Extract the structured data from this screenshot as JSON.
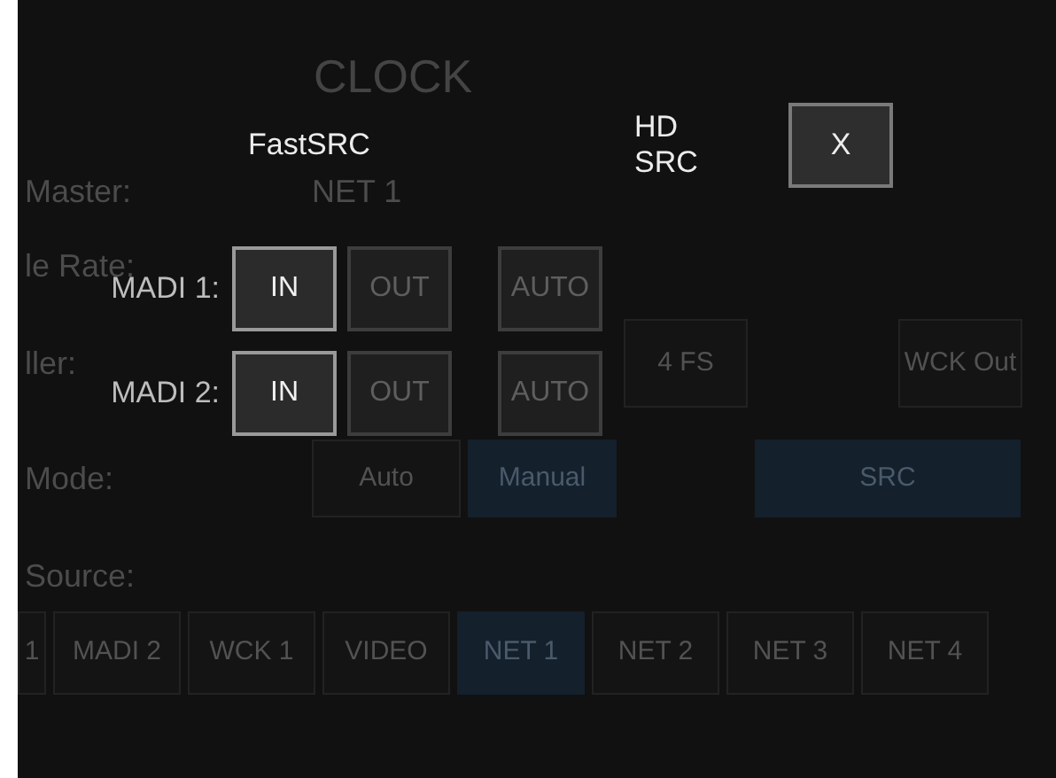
{
  "background": {
    "title": "CLOCK",
    "master": {
      "label": "Master:",
      "value": "NET 1"
    },
    "rate": {
      "label": "le Rate:"
    },
    "multiplier": {
      "label": "ller:",
      "buttons": [
        {
          "label": "4 FS",
          "selected": false
        },
        {
          "label": "WCK Out",
          "selected": false
        }
      ]
    },
    "mode": {
      "label": "Mode:",
      "buttons": [
        {
          "label": "Auto",
          "selected": false
        },
        {
          "label": "Manual",
          "selected": true
        },
        {
          "label": "SRC",
          "selected": true
        }
      ]
    },
    "source": {
      "label": "Source:",
      "buttons": [
        {
          "label": "1",
          "selected": false
        },
        {
          "label": "MADI 2",
          "selected": false
        },
        {
          "label": "WCK 1",
          "selected": false
        },
        {
          "label": "VIDEO",
          "selected": false
        },
        {
          "label": "NET 1",
          "selected": true
        },
        {
          "label": "NET 2",
          "selected": false
        },
        {
          "label": "NET 3",
          "selected": false
        },
        {
          "label": "NET 4",
          "selected": false
        }
      ]
    }
  },
  "dialog": {
    "fastsrc_label": "FastSRC",
    "hdsrc_label": "HD\nSRC",
    "close": "X",
    "rows": [
      {
        "label": "MADI 1:",
        "options": [
          {
            "label": "IN",
            "selected": true
          },
          {
            "label": "OUT",
            "selected": false
          },
          {
            "label": "AUTO",
            "selected": false
          }
        ]
      },
      {
        "label": "MADI 2:",
        "options": [
          {
            "label": "IN",
            "selected": true
          },
          {
            "label": "OUT",
            "selected": false
          },
          {
            "label": "AUTO",
            "selected": false
          }
        ]
      }
    ]
  }
}
